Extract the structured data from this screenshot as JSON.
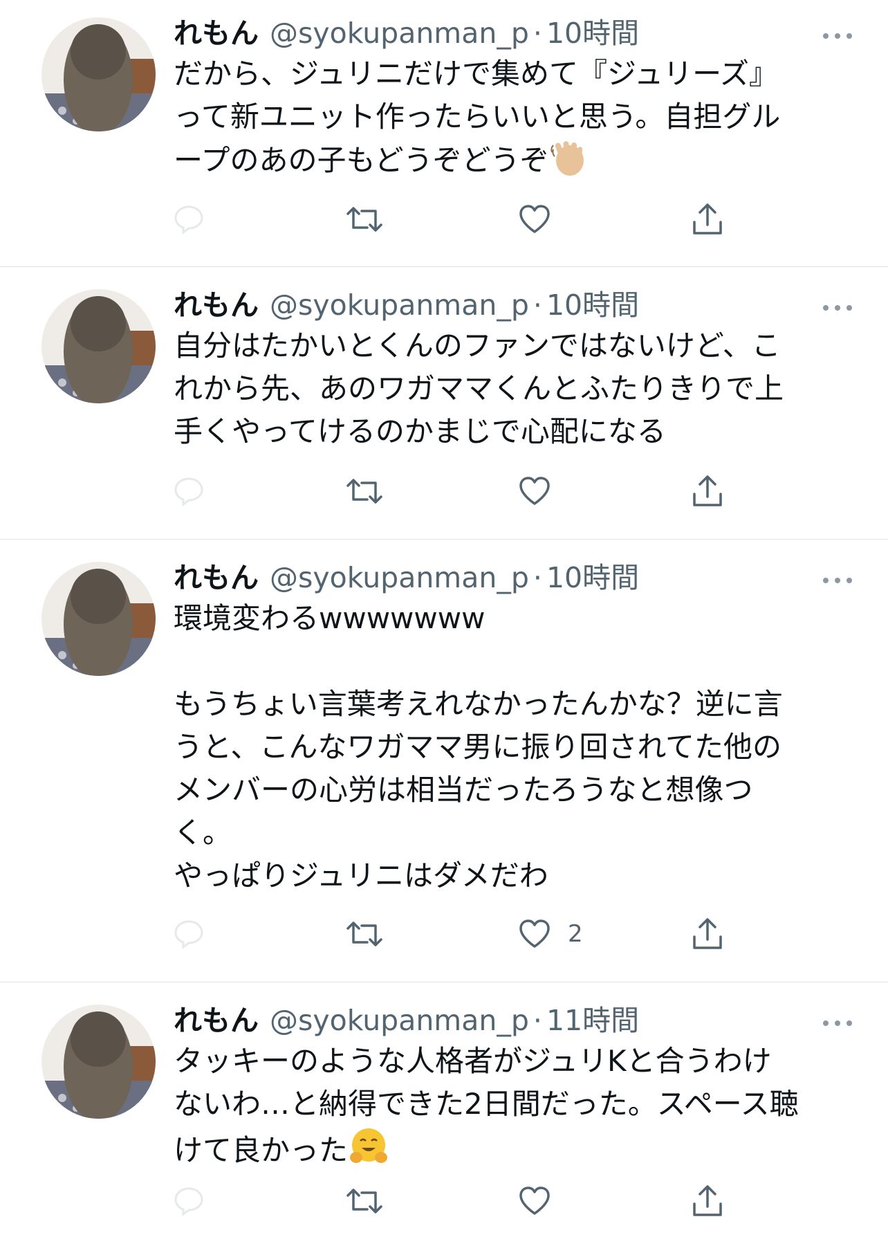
{
  "tweets": [
    {
      "name": "れもん",
      "handle": "@syokupanman_p",
      "separator": "·",
      "time": "10時間",
      "text_lines": [
        "だから、ジュリニだけで集めて『ジュリーズ』",
        "って新ユニット作ったらいいと思う。自担グル",
        "ープのあの子もどうぞどうぞ"
      ],
      "emoji": "waving-hand",
      "like_count": ""
    },
    {
      "name": "れもん",
      "handle": "@syokupanman_p",
      "separator": "·",
      "time": "10時間",
      "text_lines": [
        "自分はたかいとくんのファンではないけど、こ",
        "れから先、あのワガママくんとふたりきりで上",
        "手くやってけるのかまじで心配になる"
      ],
      "emoji": "",
      "like_count": ""
    },
    {
      "name": "れもん",
      "handle": "@syokupanman_p",
      "separator": "·",
      "time": "10時間",
      "text_lines": [
        "環境変わるwwwwwww",
        "",
        "もうちょい言葉考えれなかったんかな？逆に言",
        "うと、こんなワガママ男に振り回されてた他の",
        "メンバーの心労は相当だったろうなと想像つ",
        "く。",
        "やっぱりジュリニはダメだわ"
      ],
      "emoji": "",
      "like_count": "2"
    },
    {
      "name": "れもん",
      "handle": "@syokupanman_p",
      "separator": "·",
      "time": "11時間",
      "text_lines": [
        "タッキーのような人格者がジュリKと合うわけ",
        "ないわ…と納得できた2日間だった。スペース聴",
        "けて良かった"
      ],
      "emoji": "hugging-face",
      "like_count": ""
    }
  ],
  "icons": {
    "reply": "reply-icon",
    "retweet": "retweet-icon",
    "like": "like-icon",
    "share": "share-icon",
    "more": "more-icon"
  },
  "colors": {
    "text": "#0f1419",
    "secondary": "#536471",
    "divider": "#dfe3e6"
  }
}
